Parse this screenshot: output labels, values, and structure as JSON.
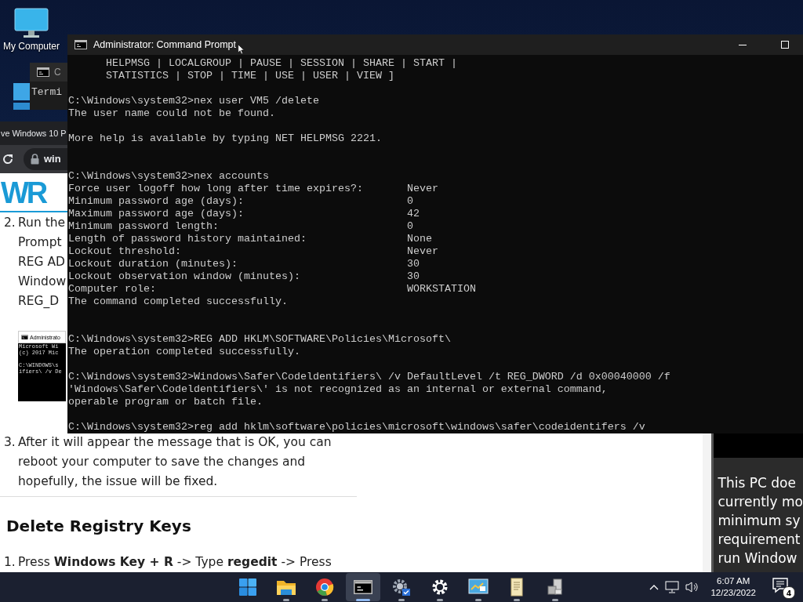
{
  "desktop": {
    "icons": [
      {
        "label": "My Computer"
      }
    ]
  },
  "back_window": {
    "title": "C",
    "body": "Termi"
  },
  "browser": {
    "tab_title": "ve Windows 10 P",
    "address": "win",
    "logo": "WR",
    "article": {
      "step_2": {
        "number": "2.",
        "lines": [
          "Run the",
          "Prompt",
          "REG AD",
          "Window",
          "REG_D"
        ]
      },
      "screenshot": {
        "title": "Administrato",
        "lines": [
          "Microsoft Wi",
          "(c) 2017 Mic",
          "C:\\WINDOWS\\s",
          "ifiers\\ /v De"
        ]
      },
      "step_3": {
        "number": "3.",
        "lines": [
          "After it will appear the message that is OK, you can",
          "reboot your computer to save the changes and",
          "hopefully, the issue will be fixed."
        ]
      },
      "heading": "Delete Registry Keys",
      "step_1": {
        "number": "1.",
        "text": "Press **Windows Key + R** -> Type **regedit** -> Press"
      }
    },
    "sidebar": {
      "lines": [
        "This PC doe",
        "currently mo",
        "minimum sy",
        "requirement",
        "run Window"
      ]
    }
  },
  "cmd": {
    "title": "Administrator: Command Prompt",
    "output": "      HELPMSG | LOCALGROUP | PAUSE | SESSION | SHARE | START |\n      STATISTICS | STOP | TIME | USE | USER | VIEW ]\n\nC:\\Windows\\system32>nex user VM5 /delete\nThe user name could not be found.\n\nMore help is available by typing NET HELPMSG 2221.\n\n\nC:\\Windows\\system32>nex accounts\nForce user logoff how long after time expires?:       Never\nMinimum password age (days):                          0\nMaximum password age (days):                          42\nMinimum password length:                              0\nLength of password history maintained:                None\nLockout threshold:                                    Never\nLockout duration (minutes):                           30\nLockout observation window (minutes):                 30\nComputer role:                                        WORKSTATION\nThe command completed successfully.\n\n\nC:\\Windows\\system32>REG ADD HKLM\\SOFTWARE\\Policies\\Microsoft\\\nThe operation completed successfully.\n\nC:\\Windows\\system32>Windows\\Safer\\Codeldentifiers\\ /v DefaultLevel /t REG_DWORD /d 0x00040000 /f\n'Windows\\Safer\\Codeldentifiers\\' is not recognized as an internal or external command,\noperable program or batch file.\n\nC:\\Windows\\system32>reg add hklm\\software\\policies\\microsoft\\windows\\safer\\codeidentifers /v"
  },
  "taskbar": {
    "apps": [
      {
        "running": false,
        "selected": false
      },
      {
        "running": true,
        "selected": false
      },
      {
        "running": true,
        "selected": false
      },
      {
        "running": true,
        "selected": true
      },
      {
        "running": true,
        "selected": false
      },
      {
        "running": true,
        "selected": false
      },
      {
        "running": true,
        "selected": false
      },
      {
        "running": true,
        "selected": false
      },
      {
        "running": true,
        "selected": false
      }
    ],
    "time": "6:07 AM",
    "date": "12/23/2022",
    "notifications": "4"
  }
}
